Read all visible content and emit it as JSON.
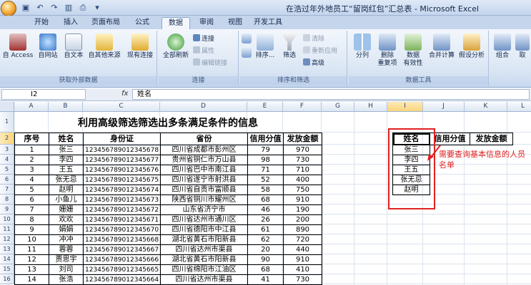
{
  "window": {
    "title": "在浩过年外地员工“留岗红包”汇总表 - Microsoft Excel",
    "qat_icons": [
      "save-icon",
      "undo-icon",
      "redo-icon",
      "chart-icon",
      "print-icon",
      "dropdown-icon"
    ]
  },
  "tabs": [
    "开始",
    "插入",
    "页面布局",
    "公式",
    "数据",
    "审阅",
    "视图",
    "开发工具"
  ],
  "active_tab": "数据",
  "ribbon": {
    "groups": {
      "external": "获取外部数据",
      "connections": "连接",
      "sort_filter": "排序和筛选",
      "data_tools": "数据工具"
    },
    "buttons": {
      "access": "自 Access",
      "web": "自网站",
      "text": "自文本",
      "other_sources": "自其他来源",
      "existing_connections": "现有连接",
      "refresh_all": "全部刷新",
      "connections": "连接",
      "properties": "属性",
      "edit_links": "编辑链接",
      "sort": "排序...",
      "filter": "筛选",
      "clear": "清除",
      "reapply": "重新应用",
      "advanced": "高级",
      "text_to_columns": "分列",
      "remove_duplicates_1": "删除",
      "remove_duplicates_2": "重复项",
      "data_validation_1": "数据",
      "data_validation_2": "有效性",
      "consolidate": "合并计算",
      "what_if": "假设分析",
      "group": "组合",
      "ungroup": "取"
    }
  },
  "formula_bar": {
    "name_box": "I2",
    "fx": "fx",
    "content": "姓名"
  },
  "columns": [
    "A",
    "B",
    "C",
    "D",
    "E",
    "F",
    "G",
    "H",
    "I",
    "J",
    "K",
    "L"
  ],
  "rows": [
    "1",
    "2",
    "3",
    "4",
    "5",
    "6",
    "7",
    "8",
    "9",
    "10",
    "11",
    "12",
    "13",
    "14",
    "15",
    "16"
  ],
  "sheet": {
    "title": "利用高级筛选筛选出多条满足条件的信息",
    "headers": [
      "序号",
      "姓名",
      "身份证",
      "省份",
      "信用分值",
      "发放金额"
    ],
    "rows": [
      [
        "1",
        "张三",
        "123456789012345678",
        "四川省成都市彭州区",
        "79",
        "970"
      ],
      [
        "2",
        "李四",
        "123456789012345677",
        "贵州省铜仁市万山县",
        "98",
        "730"
      ],
      [
        "3",
        "王五",
        "123456789012345676",
        "四川省巴中市南江县",
        "71",
        "710"
      ],
      [
        "4",
        "张无忌",
        "123456789012345675",
        "四川省遂宁市射洪县",
        "52",
        "400"
      ],
      [
        "5",
        "赵明",
        "123456789012345674",
        "四川省自贡市富顺县",
        "58",
        "750"
      ],
      [
        "6",
        "小鱼儿",
        "123456789012345673",
        "陕西省铜川市耀州区",
        "68",
        "910"
      ],
      [
        "7",
        "姗姗",
        "123456789012345672",
        "山东省济宁市",
        "46",
        "190"
      ],
      [
        "8",
        "欢欢",
        "123456789012345671",
        "四川省达州市通川区",
        "26",
        "200"
      ],
      [
        "9",
        "娟娟",
        "123456789012345670",
        "四川省德阳市中江县",
        "61",
        "890"
      ],
      [
        "10",
        "冲冲",
        "123456789012345668",
        "湖北省黄石市阳新县",
        "62",
        "720"
      ],
      [
        "11",
        "蓉蓉",
        "123456789012345667",
        "四川省达州市渠县",
        "20",
        "440"
      ],
      [
        "12",
        "贾思宇",
        "123456789012345666",
        "湖北省黄石市阳新县",
        "90",
        "910"
      ],
      [
        "13",
        "刘司",
        "123456789012345665",
        "四川省绵阳市江油区",
        "68",
        "410"
      ],
      [
        "14",
        "张浩",
        "123456789012345664",
        "四川省达州市渠县",
        "41",
        "730"
      ]
    ]
  },
  "criteria": {
    "headers": [
      "姓名",
      "信用分值",
      "发放金额"
    ],
    "names": [
      "张三",
      "李四",
      "王五",
      "张无忌",
      "赵明"
    ]
  },
  "annotation": "需要查询基本信息的人员名单",
  "colors": {
    "annotation": "#e02020",
    "selection": "#f9d57b",
    "ribbon": "#dbe6f4"
  }
}
